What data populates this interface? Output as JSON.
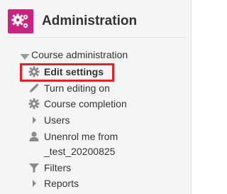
{
  "block": {
    "title": "Administration",
    "logo_icon": "cogs-icon",
    "accent_color": "#c9237f"
  },
  "tree": {
    "section_label": "Course administration",
    "items": [
      {
        "label": "Edit settings",
        "icon": "gear-icon",
        "highlighted": true
      },
      {
        "label": "Turn editing on",
        "icon": "pencil-icon"
      },
      {
        "label": "Course completion",
        "icon": "gear-icon"
      },
      {
        "label": "Users",
        "icon": "caret-right-icon"
      },
      {
        "label_line1": "Unenrol me from",
        "label_line2": "_test_20200825",
        "icon": "user-icon"
      },
      {
        "label": "Filters",
        "icon": "filter-icon"
      },
      {
        "label": "Reports",
        "icon": "caret-right-icon"
      }
    ]
  },
  "highlight_color": "#e02424"
}
